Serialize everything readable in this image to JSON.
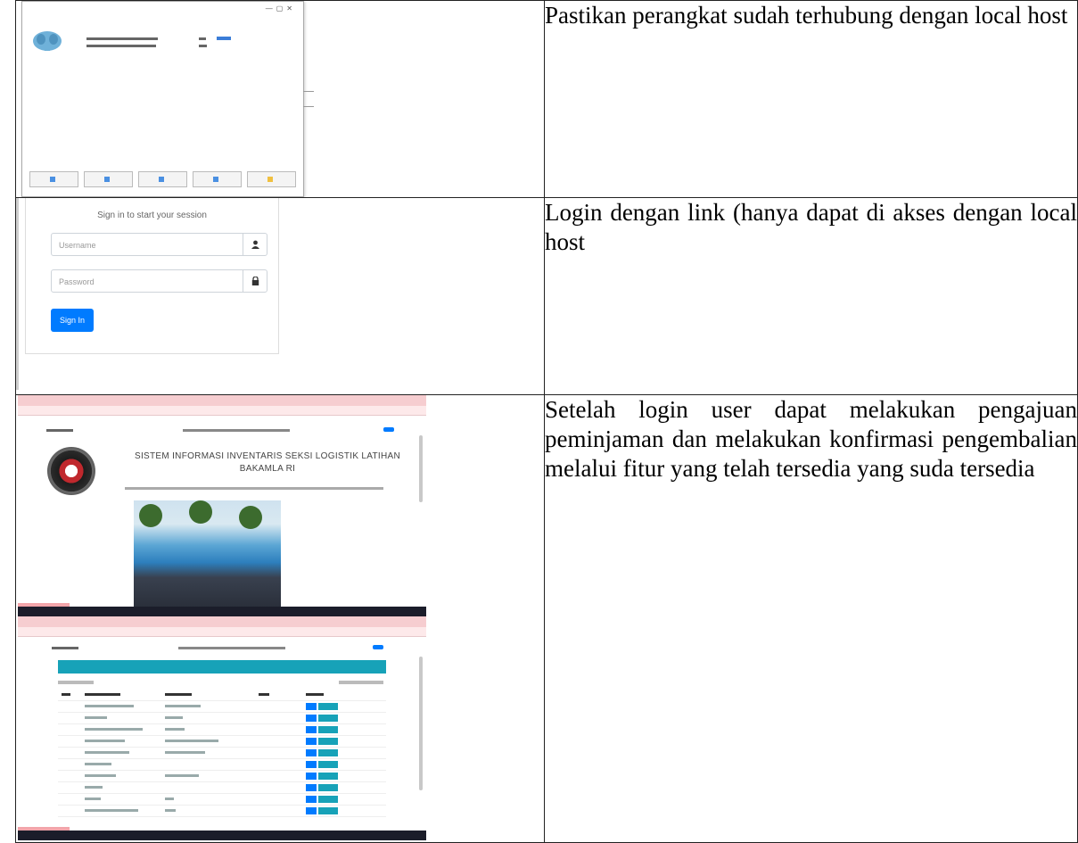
{
  "rows": [
    {
      "description": "Pastikan perangkat sudah terhubung dengan local host",
      "screenshot": {
        "kind": "control-panel-window",
        "buttons": [
          "",
          "",
          "",
          "",
          ""
        ]
      }
    },
    {
      "description": "Login dengan link (hanya dapat di akses dengan local host",
      "screenshot": {
        "kind": "login-form",
        "title": "Sign in to start your session",
        "username_placeholder": "Username",
        "password_placeholder": "Password",
        "signin_label": "Sign In",
        "user_icon": "user-icon",
        "lock_icon": "lock-icon"
      }
    },
    {
      "description": "Setelah login user dapat melakukan pengajuan peminjaman dan melakukan konfirmasi pengembalian melalui fitur yang telah tersedia  yang suda tersedia",
      "screenshots": [
        {
          "kind": "home-page",
          "hero_title": "SISTEM INFORMASI INVENTARIS SEKSI LOGISTIK LATIHAN BAKAMLA RI"
        },
        {
          "kind": "item-list-page"
        }
      ]
    }
  ],
  "colors": {
    "primary_button": "#007bff",
    "info_header": "#17a2b8",
    "browser_tabbar": "#f6cdd0"
  }
}
